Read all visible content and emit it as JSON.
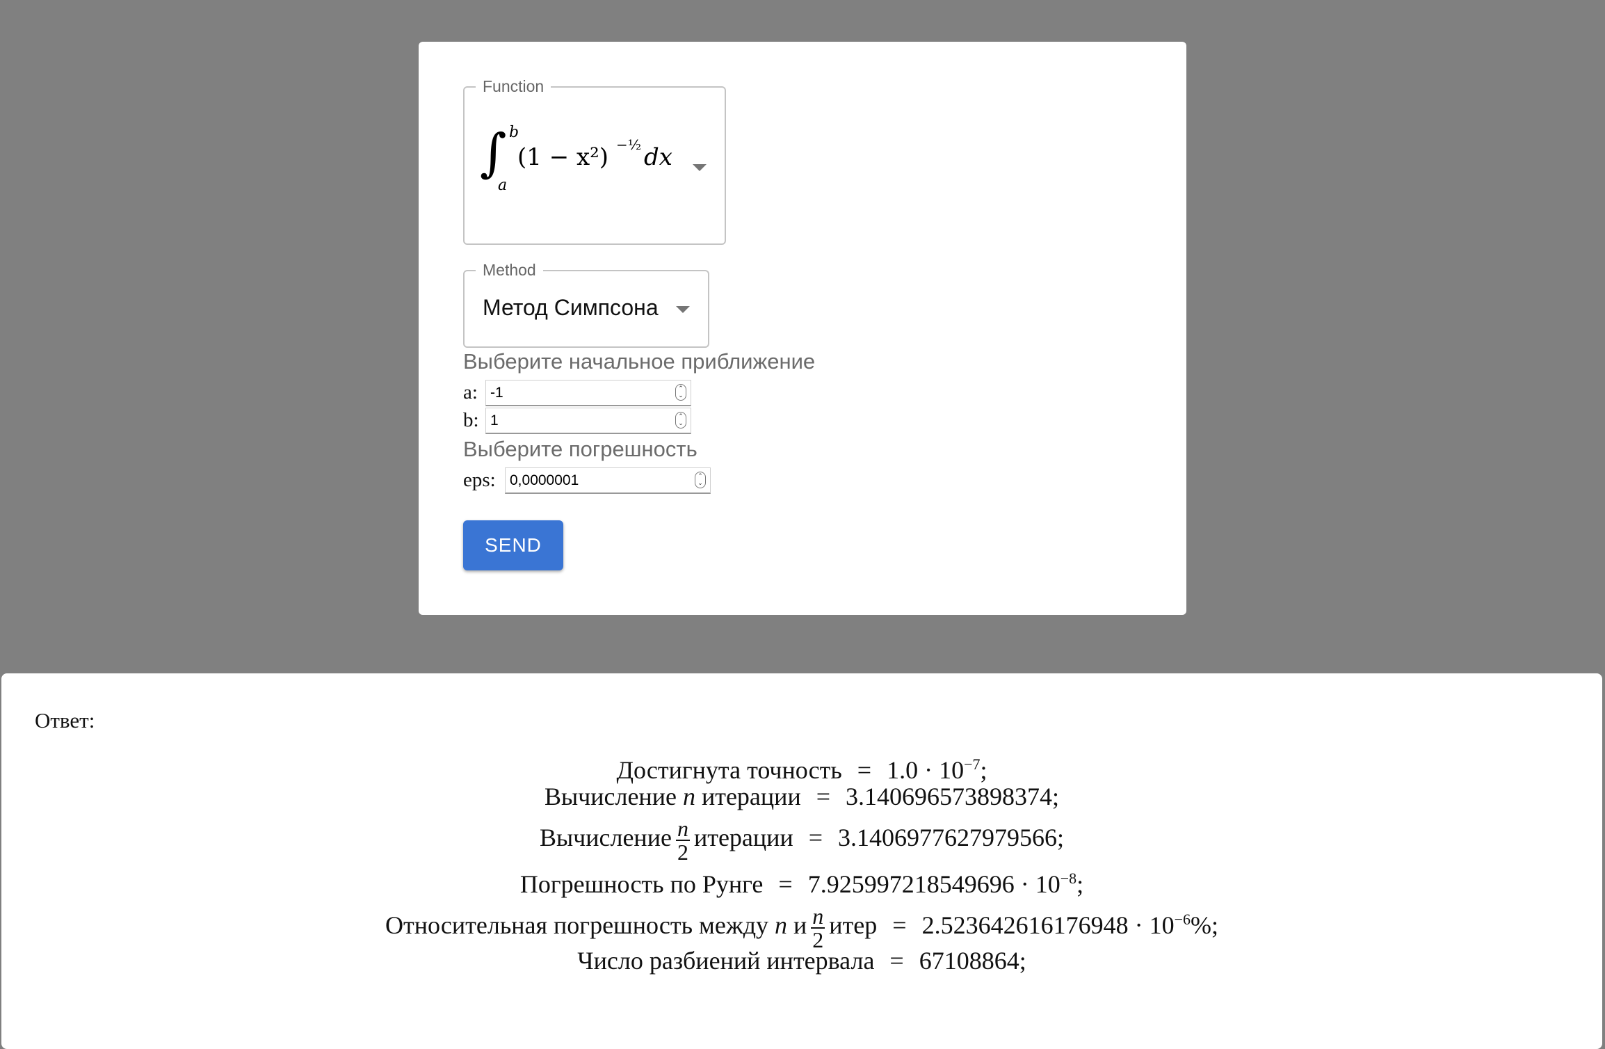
{
  "form": {
    "function_field": {
      "legend": "Function",
      "expression_lower": "a",
      "expression_upper": "b",
      "expression_body": "(1 − x²)",
      "expression_exp": "−½",
      "expression_dx": "dx"
    },
    "method_field": {
      "legend": "Method",
      "value": "Метод Симпсона"
    },
    "initial_hint": "Выберите начальное приближение",
    "a_label": "a:",
    "a_value": "-1",
    "b_label": "b:",
    "b_value": "1",
    "eps_hint": "Выберите погрешность",
    "eps_label": "eps:",
    "eps_value": "0,0000001",
    "send_label": "SEND"
  },
  "answer": {
    "title": "Ответ:",
    "lines": {
      "accuracy": {
        "label": "Достигнута точность",
        "value": "1.0 · 10",
        "exp": "−7",
        "suffix": ";"
      },
      "n_iter": {
        "label_pre": "Вычисление",
        "var": "n",
        "label_post": "итерации",
        "value": "3.140696573898374;"
      },
      "n2_iter": {
        "label_pre": "Вычисление",
        "num": "n",
        "den": "2",
        "label_post": "итерации",
        "value": "3.1406977627979566;"
      },
      "runge": {
        "label": "Погрешность по Рунге",
        "value": "7.925997218549696 · 10",
        "exp": "−8",
        "suffix": ";"
      },
      "relative": {
        "label_pre": "Относительная погрешность между",
        "var": "n",
        "and": "и",
        "num": "n",
        "den": "2",
        "label_post": "итер",
        "value": "2.523642616176948 · 10",
        "exp": "−6",
        "suffix": "%;"
      },
      "partitions": {
        "label": "Число разбиений интервала",
        "value": "67108864;"
      }
    },
    "eq": "="
  },
  "colors": {
    "background": "#808080",
    "card": "#ffffff",
    "accent": "#3a75d4"
  }
}
